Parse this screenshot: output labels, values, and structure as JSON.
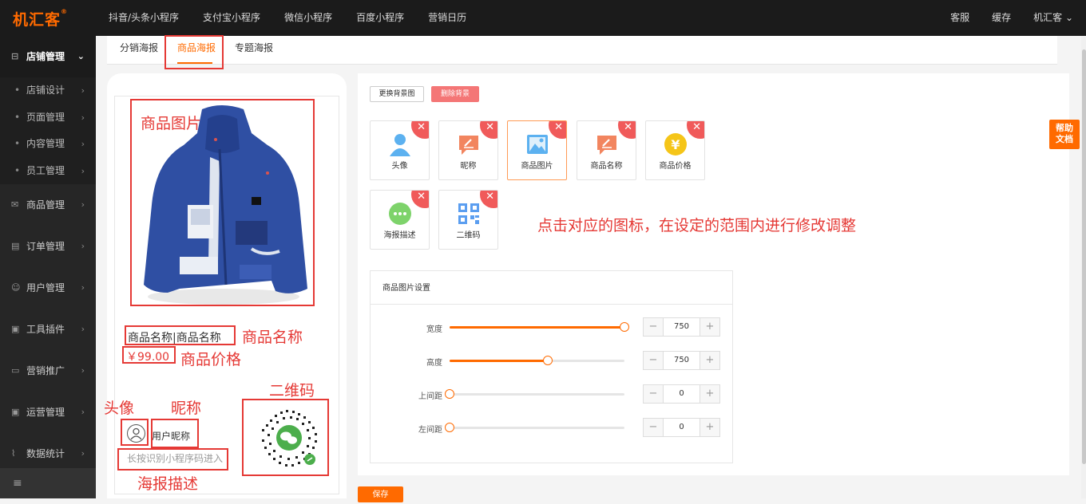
{
  "brand": {
    "logo": "机汇客",
    "reg": "®"
  },
  "topnav": [
    "抖音/头条小程序",
    "支付宝小程序",
    "微信小程序",
    "百度小程序",
    "营销日历"
  ],
  "topright": [
    "客服",
    "缓存",
    "机汇客 ⌄"
  ],
  "sidebar": {
    "active": {
      "icon": "⊟",
      "label": "店铺管理"
    },
    "subitems": [
      "店铺设计",
      "页面管理",
      "内容管理",
      "员工管理"
    ],
    "items": [
      {
        "icon": "✉",
        "label": "商品管理"
      },
      {
        "icon": "▤",
        "label": "订单管理"
      },
      {
        "icon": "☺",
        "label": "用户管理"
      },
      {
        "icon": "▣",
        "label": "工具插件"
      },
      {
        "icon": "▭",
        "label": "营销推广"
      },
      {
        "icon": "▣",
        "label": "运营管理"
      },
      {
        "icon": "⌇",
        "label": "数据统计"
      }
    ],
    "bottom": "≡"
  },
  "tabs": [
    "分销海报",
    "商品海报",
    "专题海报"
  ],
  "poster": {
    "product_name": "商品名称|商品名称",
    "price": "￥99.00",
    "nickname": "用户昵称",
    "desc": "长按识别小程序码进入"
  },
  "annotations": {
    "image": "商品图片",
    "name": "商品名称",
    "price": "商品价格",
    "qr": "二维码",
    "avatar": "头像",
    "nick": "昵称",
    "desc": "海报描述",
    "hint": "点击对应的图标，在设定的范围内进行修改调整"
  },
  "buttons": {
    "replace_bg": "更换背景图",
    "delete_bg": "删除背景",
    "save": "保存"
  },
  "elements": [
    {
      "label": "头像",
      "icon": "user-icon",
      "color": "#5cb1f0"
    },
    {
      "label": "昵称",
      "icon": "edit-icon",
      "color": "#f2855f"
    },
    {
      "label": "商品图片",
      "icon": "image-icon",
      "color": "#5cb1f0"
    },
    {
      "label": "商品名称",
      "icon": "edit-icon",
      "color": "#f2855f"
    },
    {
      "label": "商品价格",
      "icon": "yen-icon",
      "color": "#f5c518"
    },
    {
      "label": "海报描述",
      "icon": "chat-icon",
      "color": "#7ed36b"
    },
    {
      "label": "二维码",
      "icon": "qrcode-icon",
      "color": "#5b9ef0"
    }
  ],
  "settings": {
    "title": "商品图片设置",
    "rows": [
      {
        "label": "宽度",
        "value": "750",
        "level": 1.0
      },
      {
        "label": "高度",
        "value": "750",
        "level": 0.56
      },
      {
        "label": "上间距",
        "value": "0",
        "level": 0.0
      },
      {
        "label": "左间距",
        "value": "0",
        "level": 0.0
      }
    ]
  },
  "help": {
    "line1": "帮助",
    "line2": "文档"
  },
  "colors": {
    "accent": "#ff6a00",
    "danger": "#e53935"
  }
}
